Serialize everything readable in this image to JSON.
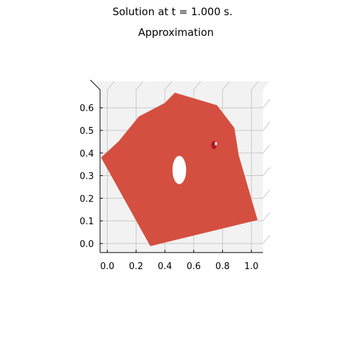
{
  "figure": {
    "suptitle": "Solution at t = 1.000 s.",
    "title": "Approximation"
  },
  "colors": {
    "surface": "#d44f40",
    "marker": "#b01a2a",
    "pane": "#f2f2f2",
    "grid": "#c8c8c8",
    "axis": "#000000"
  },
  "chart_data": {
    "type": "surface",
    "view": "top-down 3D",
    "xlim": [
      -0.05,
      1.08
    ],
    "ylim": [
      -0.04,
      0.68
    ],
    "x_ticks": [
      0.0,
      0.2,
      0.4,
      0.6,
      0.8,
      1.0
    ],
    "x_tick_labels": [
      "0.0",
      "0.2",
      "0.4",
      "0.6",
      "0.8",
      "1.0"
    ],
    "y_ticks": [
      0.0,
      0.1,
      0.2,
      0.3,
      0.4,
      0.5,
      0.6
    ],
    "y_tick_labels": [
      "0.0",
      "0.1",
      "0.2",
      "0.3",
      "0.4",
      "0.5",
      "0.6"
    ],
    "grid": true,
    "domain_boundary": [
      {
        "x": -0.04,
        "y": 0.38
      },
      {
        "x": 0.08,
        "y": 0.45
      },
      {
        "x": 0.22,
        "y": 0.56
      },
      {
        "x": 0.4,
        "y": 0.62
      },
      {
        "x": 0.47,
        "y": 0.665
      },
      {
        "x": 0.76,
        "y": 0.61
      },
      {
        "x": 0.88,
        "y": 0.51
      },
      {
        "x": 0.91,
        "y": 0.39
      },
      {
        "x": 1.04,
        "y": 0.105
      },
      {
        "x": 0.3,
        "y": -0.01
      }
    ],
    "hole": {
      "cx": 0.5,
      "cy": 0.325,
      "rx": 0.05,
      "ry": 0.05
    },
    "markers": [
      {
        "x": 0.74,
        "y": 0.435
      }
    ]
  }
}
